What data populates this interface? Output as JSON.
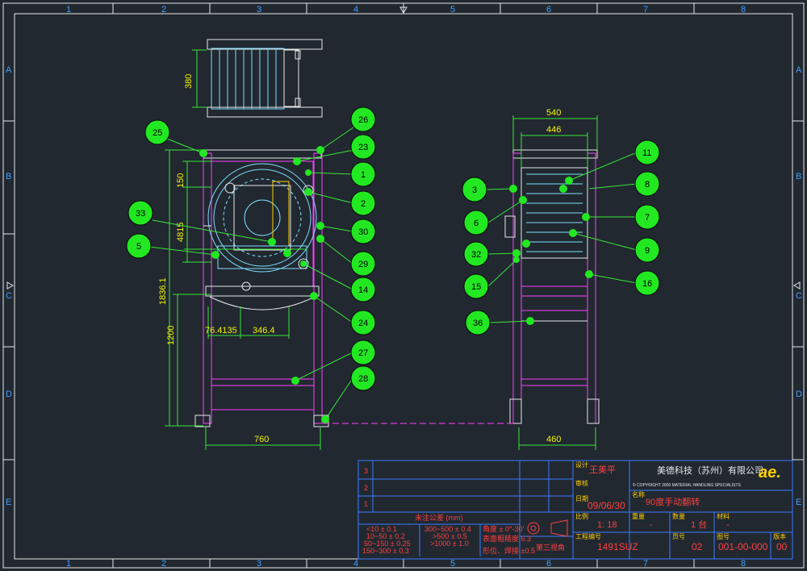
{
  "border_grid": {
    "columns": [
      "1",
      "2",
      "3",
      "4",
      "5",
      "6",
      "7",
      "8"
    ],
    "rows": [
      "A",
      "B",
      "C",
      "D",
      "E"
    ]
  },
  "top_view": {
    "dim_380": "380"
  },
  "front_view": {
    "dim_150": "150",
    "dim_4815": "4815",
    "dim_18361": "1836.1",
    "dim_1200": "1200",
    "dim_764135": "76.4135",
    "dim_3464": "346.4",
    "dim_760": "760"
  },
  "side_view": {
    "dim_540": "540",
    "dim_446": "446",
    "dim_460": "460"
  },
  "balloons": [
    "25",
    "26",
    "23",
    "1",
    "2",
    "33",
    "30",
    "5",
    "29",
    "14",
    "24",
    "27",
    "28",
    "11",
    "3",
    "8",
    "6",
    "7",
    "32",
    "9",
    "15",
    "16",
    "36"
  ],
  "title_block": {
    "rev_rows": [
      "3",
      "2",
      "1"
    ],
    "designer": "王美平",
    "label_designer": "设计",
    "label_review": "审核",
    "label_date": "日期",
    "date": "09/06/30",
    "company": "美德科技（苏州）有限公司",
    "logo": "ae.",
    "copyright": "© COPYRIGHT 2000   MATERIAL HANDLING SPECIALISTS",
    "label_name": "名称",
    "drawing_name": "90度手动翻转",
    "label_scale": "比例",
    "scale": "1: 18",
    "label_weight": "重量",
    "weight": "-",
    "label_qty": "数量",
    "qty": "1 台",
    "label_material": "材料",
    "material": "-",
    "tolerance_title": "未注公差 (mm)",
    "tolerances": [
      [
        "<10 ± 0.1",
        "300~500 ± 0.4"
      ],
      [
        "10~50 ± 0.2",
        ">500 ± 0.5"
      ],
      [
        "50~150 ± 0.25",
        ">1000 ± 1.0"
      ],
      [
        "150~300 ± 0.3",
        ""
      ]
    ],
    "tol_notes": [
      "角度 ± 0°-30'",
      "表面粗糙度 6.3",
      "形位、焊接 ±0.5"
    ],
    "projection_label": "第三视角",
    "label_project_no": "工程编号",
    "project_no": "1491SUZ",
    "label_sheet": "页号",
    "sheet": "02",
    "label_drawing_no": "图号",
    "drawing_no": "001-00-000",
    "label_rev": "版本",
    "rev": "00"
  }
}
